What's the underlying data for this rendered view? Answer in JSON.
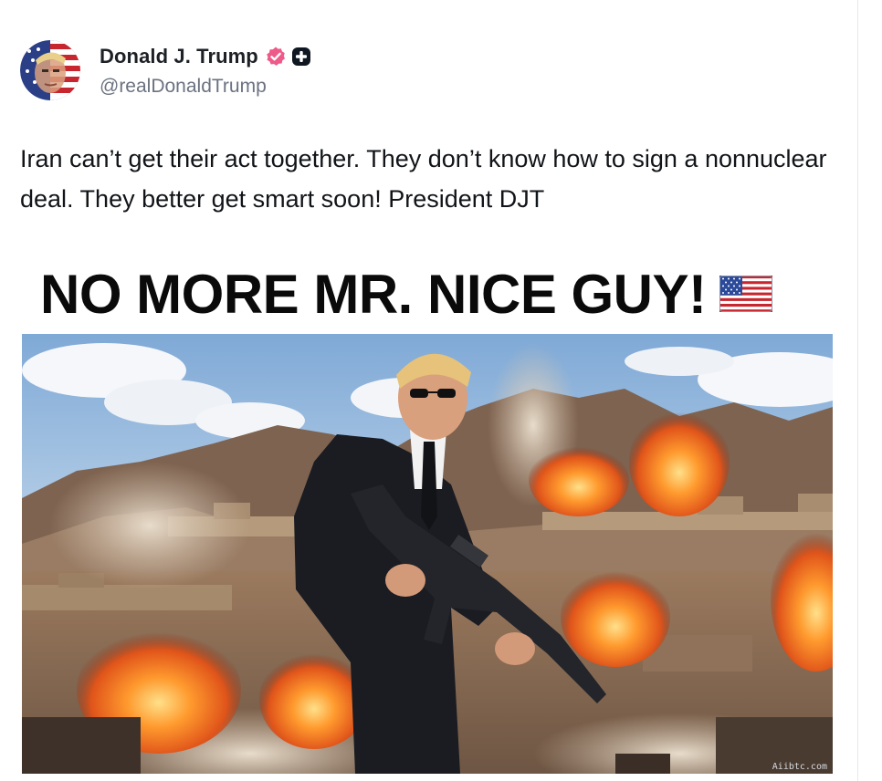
{
  "post": {
    "author": {
      "display_name": "Donald J. Trump",
      "handle": "@realDonaldTrump",
      "verified_icon": "verified-badge-icon",
      "extra_icon": "plus-badge-icon"
    },
    "text": "Iran can’t get their act together. They don’t know how to sign a nonnuclear deal. They better get smart soon! President DJT",
    "media": {
      "caption_text": "NO MORE MR. NICE GUY!",
      "caption_icon": "us-flag-icon"
    }
  },
  "watermark": "Aiibtc.com",
  "colors": {
    "verified": "#ee5a8a",
    "name": "#1d2126",
    "handle": "#6b7280"
  }
}
